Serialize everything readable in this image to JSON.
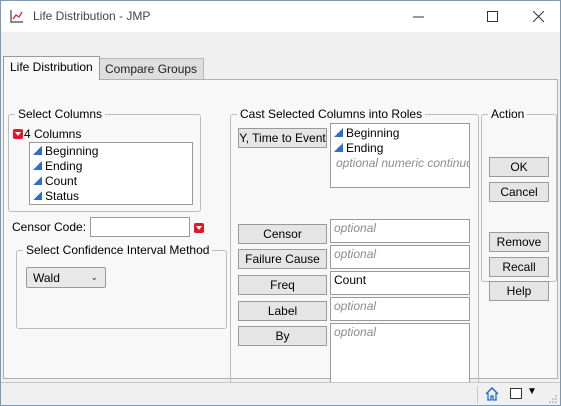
{
  "window": {
    "title": "Life Distribution - JMP",
    "minimize_glyph": "—",
    "maximize_glyph": "☐",
    "close_glyph": "✕"
  },
  "tabs": [
    {
      "label": "Life Distribution",
      "active": true
    },
    {
      "label": "Compare Groups",
      "active": false
    }
  ],
  "select_columns": {
    "label": "Select Columns",
    "count_label": "4 Columns",
    "items": [
      "Beginning",
      "Ending",
      "Count",
      "Status"
    ]
  },
  "censor_code": {
    "label": "Censor Code:",
    "value": ""
  },
  "ci_method": {
    "label": "Select Confidence Interval Method",
    "selected": "Wald"
  },
  "cast_roles": {
    "label": "Cast Selected Columns into Roles",
    "roles": [
      {
        "button": "Y, Time to Event",
        "values": [
          "Beginning",
          "Ending"
        ],
        "placeholder": "optional numeric continuous"
      },
      {
        "button": "Censor",
        "values": [],
        "placeholder": "optional"
      },
      {
        "button": "Failure Cause",
        "values": [],
        "placeholder": "optional"
      },
      {
        "button": "Freq",
        "values": [
          "Count"
        ],
        "placeholder": ""
      },
      {
        "button": "Label",
        "values": [],
        "placeholder": "optional"
      },
      {
        "button": "By",
        "values": [],
        "placeholder": "optional"
      }
    ]
  },
  "action": {
    "label": "Action",
    "ok": "OK",
    "cancel": "Cancel",
    "remove": "Remove",
    "recall": "Recall",
    "help": "Help"
  },
  "colors": {
    "continuous_icon": "#2b6fc9",
    "red_triangle": "#e8132a",
    "placeholder_text": "#8c8c8c"
  },
  "icons": {
    "app": "jmp-chart-icon",
    "home": "home-icon",
    "window": "window-icon",
    "dropdown": "dropdown-arrow-icon"
  }
}
